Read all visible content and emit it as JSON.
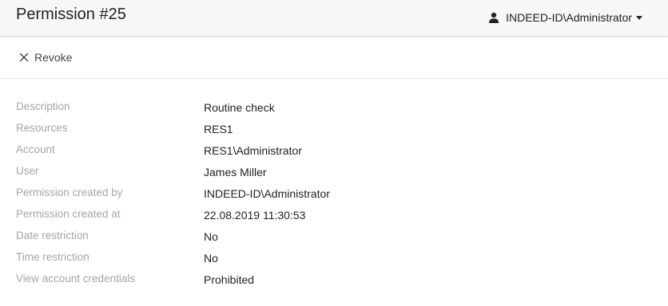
{
  "header": {
    "title": "Permission #25",
    "user": "INDEED-ID\\Administrator"
  },
  "toolbar": {
    "revoke_label": "Revoke"
  },
  "details": [
    {
      "label": "Description",
      "value": "Routine check"
    },
    {
      "label": "Resources",
      "value": "RES1"
    },
    {
      "label": "Account",
      "value": "RES1\\Administrator"
    },
    {
      "label": "User",
      "value": "James Miller"
    },
    {
      "label": "Permission created by",
      "value": "INDEED-ID\\Administrator"
    },
    {
      "label": "Permission created at",
      "value": "22.08.2019 11:30:53"
    },
    {
      "label": "Date restriction",
      "value": "No"
    },
    {
      "label": "Time restriction",
      "value": "No"
    },
    {
      "label": "View account credentials",
      "value": "Prohibited"
    }
  ],
  "icons": {
    "user": "user-icon",
    "revoke": "close-icon",
    "dropdown": "caret-down-icon"
  },
  "colors": {
    "header_bg": "#f7f7f8",
    "label_text": "#a5a5a8",
    "value_text": "#222222"
  }
}
